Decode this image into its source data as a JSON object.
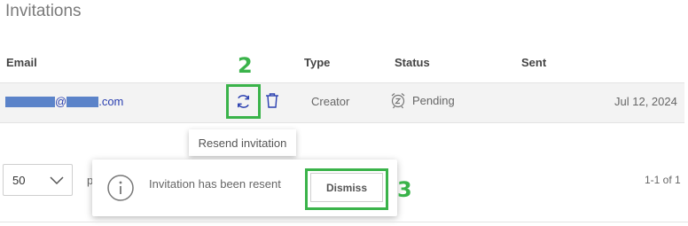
{
  "page_title": "Invitations",
  "table": {
    "headers": {
      "email": "Email",
      "type": "Type",
      "status": "Status",
      "sent": "Sent"
    },
    "rows": [
      {
        "email_at": "@",
        "email_domain_suffix": ".com",
        "type": "Creator",
        "status": "Pending",
        "sent": "Jul 12, 2024"
      }
    ]
  },
  "annotations": {
    "step_2": "2",
    "step_3": "3"
  },
  "tooltip": {
    "text": "Resend invitation"
  },
  "pagination": {
    "page_size": "50",
    "range": "1-1 of 1"
  },
  "toast": {
    "message": "Invitation has been resent",
    "dismiss_label": "Dismiss"
  },
  "colors": {
    "annotation_green": "#3ab34a",
    "email_link": "#2a3fb0",
    "resend_icon": "#2a3fb0",
    "delete_icon": "#2a3fb0"
  },
  "icons": {
    "resend": "refresh-icon",
    "delete": "trash-icon",
    "status": "alarm-clock-z-icon",
    "info": "info-circle-icon",
    "dropdown": "chevron-down-icon"
  }
}
